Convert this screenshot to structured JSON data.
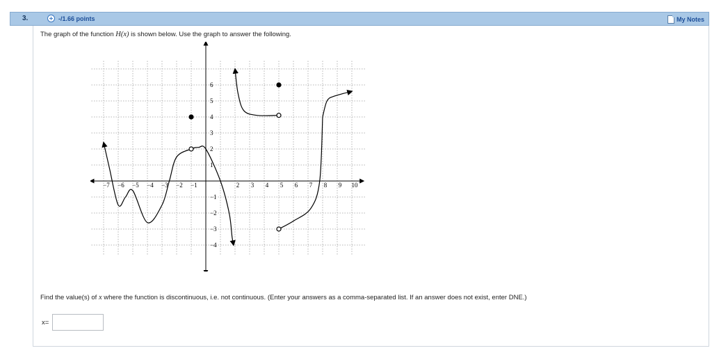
{
  "question": {
    "number": "3.",
    "points": "-/1.66 points",
    "notes_label": "My Notes"
  },
  "prompt": {
    "pre": "The graph of the function ",
    "func": "H(x)",
    "post": " is shown below. Use the graph to answer the following."
  },
  "graph": {
    "x_tick_labels": [
      "−7",
      "−6",
      "−5",
      "−4",
      "−3",
      "−2",
      "−1",
      "2",
      "3",
      "4",
      "5",
      "6",
      "7",
      "8",
      "9",
      "10"
    ],
    "y_tick_labels": [
      "6",
      "5",
      "4",
      "3",
      "2",
      "1",
      "−1",
      "−2",
      "−3",
      "−4"
    ]
  },
  "chart_data": {
    "type": "line",
    "x_range": [
      -7,
      10
    ],
    "y_range": [
      -4,
      6
    ],
    "grid": true,
    "pieces": [
      {
        "x": [
          -7,
          -6.6,
          -6,
          -5.5,
          -5,
          -4,
          -3,
          -2.5,
          -2,
          -1,
          -0.5,
          0,
          1,
          1.6,
          1.8,
          1.9
        ],
        "y": [
          2.4,
          0.8,
          -1.5,
          -1,
          -0.6,
          -2.6,
          -1.5,
          0,
          1.5,
          2,
          2.1,
          2,
          0,
          -2,
          -3.5,
          -4
        ],
        "arrow_start": true,
        "arrow_end": true
      },
      {
        "x": [
          2,
          2.2,
          2.6,
          3.5,
          5
        ],
        "y": [
          7,
          5.5,
          4.4,
          4.1,
          4.1
        ],
        "arrow_start": true
      },
      {
        "x": [
          5,
          6,
          7.2,
          7.8,
          8
        ],
        "y": [
          -3,
          -2.5,
          -1.7,
          0,
          4
        ],
        "open_start": true
      },
      {
        "x": [
          8,
          8.3,
          8.8,
          10
        ],
        "y": [
          4,
          5,
          5.3,
          5.6
        ],
        "arrow_end": true
      }
    ],
    "points": [
      {
        "x": -1,
        "y": 4,
        "filled": true
      },
      {
        "x": -1,
        "y": 2,
        "filled": false
      },
      {
        "x": 5,
        "y": 6,
        "filled": true
      },
      {
        "x": 5,
        "y": 4.1,
        "filled": false
      },
      {
        "x": 5,
        "y": -3,
        "filled": false
      }
    ]
  },
  "find": {
    "pre": "Find the value(s) of ",
    "var": "x",
    "post": " where the function is discontinuous, i.e. not continuous. (Enter your answers as a comma-separated list. If an answer does not exist, enter DNE.)"
  },
  "answer": {
    "label": "x=",
    "value": "",
    "placeholder": ""
  },
  "colors": {
    "header": "#a9c8e6",
    "points_text": "#1e4f99",
    "curve": "#000000",
    "grid": "#b5b5b5"
  }
}
